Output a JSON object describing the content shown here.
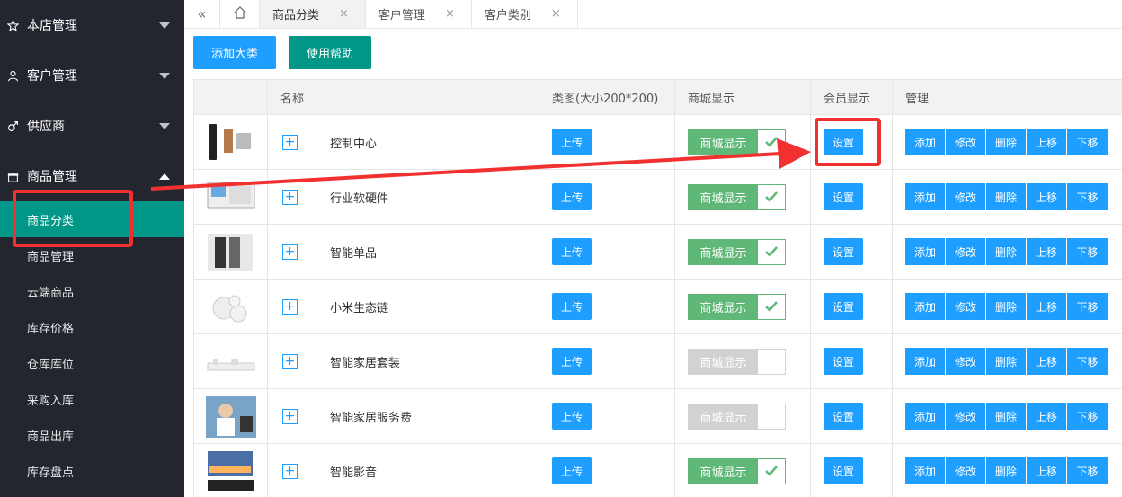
{
  "colors": {
    "sidebar_bg": "#23262e",
    "active": "#009688",
    "primary": "#1e9fff",
    "switch_on": "#5fb878",
    "switch_off": "#d2d2d2",
    "highlight": "#f23030"
  },
  "sidebar": {
    "groups": [
      {
        "label": "本店管理",
        "icon": "star-icon"
      },
      {
        "label": "客户管理",
        "icon": "user-icon"
      },
      {
        "label": "供应商",
        "icon": "male-icon"
      },
      {
        "label": "商品管理",
        "icon": "gift-icon",
        "expanded": true
      }
    ],
    "items": [
      "商品分类",
      "商品管理",
      "云端商品",
      "库存价格",
      "仓库库位",
      "采购入库",
      "商品出库",
      "库存盘点"
    ]
  },
  "tabs": [
    {
      "label": "商品分类",
      "close": "×"
    },
    {
      "label": "客户管理",
      "close": "×"
    },
    {
      "label": "客户类别",
      "close": "×"
    }
  ],
  "tabbar": {
    "prev_icon": "«",
    "home_icon": "home-icon"
  },
  "toolbar": {
    "add_category": "添加大类",
    "help": "使用帮助"
  },
  "table": {
    "headers": [
      "",
      "名称",
      "类图(大小200*200)",
      "商城显示",
      "会员显示",
      "管理"
    ],
    "upload_label": "上传",
    "switch_label": "商城显示",
    "setting_label": "设置",
    "ops": [
      "添加",
      "修改",
      "删除",
      "上移",
      "下移"
    ],
    "expand_symbol": "+",
    "rows": [
      {
        "name": "控制中心",
        "mall": true
      },
      {
        "name": "行业软硬件",
        "mall": true
      },
      {
        "name": "智能单品",
        "mall": true
      },
      {
        "name": "小米生态链",
        "mall": true
      },
      {
        "name": "智能家居套装",
        "mall": false
      },
      {
        "name": "智能家居服务费",
        "mall": false
      },
      {
        "name": "智能影音",
        "mall": true
      }
    ]
  }
}
